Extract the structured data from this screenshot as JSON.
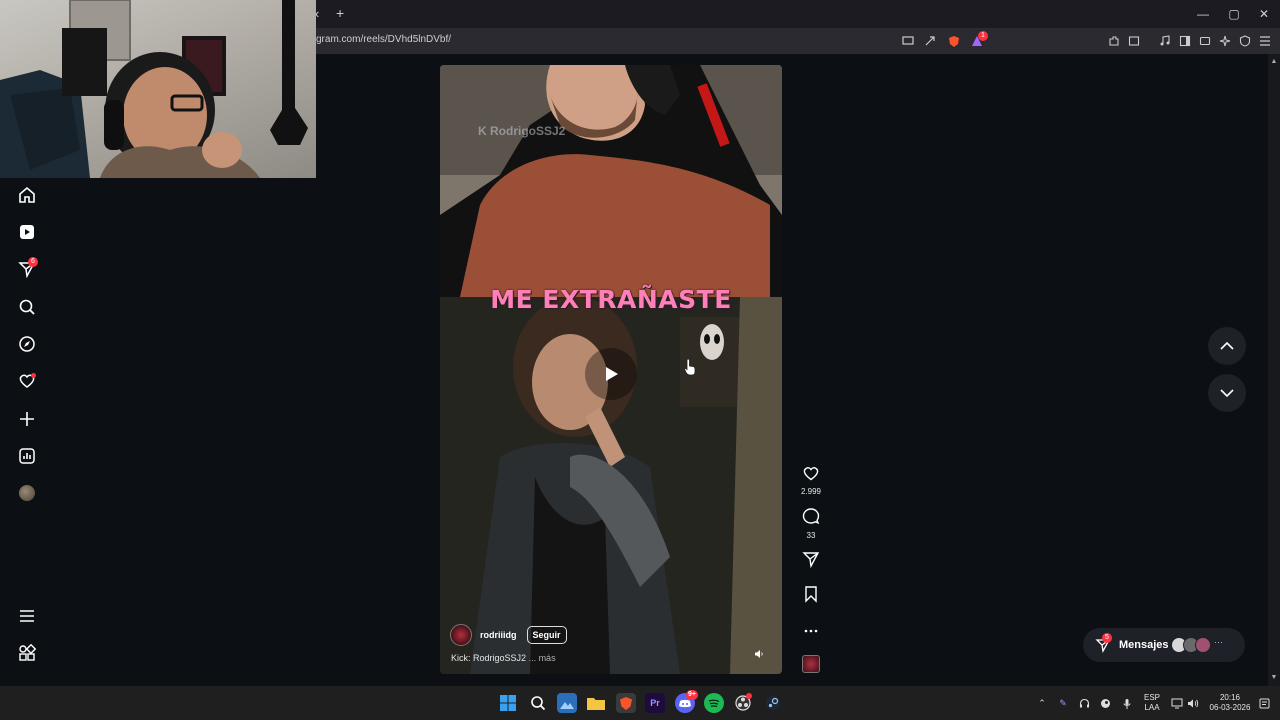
{
  "browser": {
    "url": "gram.com/reels/DVhd5lnDVbf/",
    "new_tab_label": "+",
    "tab_scroll_label": "‹",
    "window_minimize": "—",
    "window_restore": "▢",
    "window_close": "✕",
    "extension_badge": "1"
  },
  "sidebar": {
    "items": [
      {
        "name": "home"
      },
      {
        "name": "reels"
      },
      {
        "name": "messages",
        "badge": "6"
      },
      {
        "name": "search"
      },
      {
        "name": "explore"
      },
      {
        "name": "notifications"
      },
      {
        "name": "create"
      },
      {
        "name": "dashboard"
      },
      {
        "name": "profile"
      }
    ],
    "more_label": "more",
    "also_from_meta": "also-from-meta"
  },
  "reel": {
    "watermark": "RodrigoSSJ2",
    "overlay_caption": "ME EXTRAÑASTE",
    "author": "rodriiidg",
    "follow_label": "Seguir",
    "caption": "Kick: RodrigoSSJ2",
    "caption_more": "... más"
  },
  "actions": {
    "likes": "2.999",
    "comments": "33"
  },
  "messages_widget": {
    "label": "Mensajes",
    "badge": "5"
  },
  "taskbar": {
    "language_top": "ESP",
    "language_bottom": "LAA",
    "time": "20:16",
    "date": "06-03-2026",
    "discord_badge": "9+"
  },
  "colors": {
    "accent_pink": "#ff7fb8",
    "notification_red": "#ff3040",
    "background": "#0c1014"
  }
}
